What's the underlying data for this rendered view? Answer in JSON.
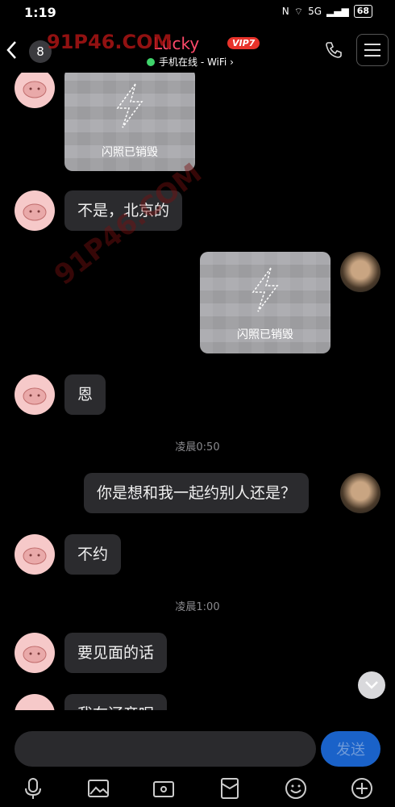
{
  "status_bar": {
    "time": "1:19",
    "signal": "5G",
    "battery": "68"
  },
  "header": {
    "unread_count": "8",
    "contact_name": "Lucky",
    "vip_label": "VIP7",
    "online_status": "手机在线 - WiFi ›"
  },
  "watermark": {
    "text_top": "91P46.COM",
    "text_diagonal": "91P46.COM"
  },
  "messages": [
    {
      "side": "left",
      "type": "flash",
      "label": "闪照已销毁"
    },
    {
      "side": "left",
      "type": "text",
      "text": "不是，北京的"
    },
    {
      "side": "right",
      "type": "flash",
      "label": "闪照已销毁"
    },
    {
      "side": "left",
      "type": "text",
      "text": "恩"
    },
    {
      "type": "time",
      "text": "凌晨0:50"
    },
    {
      "side": "right",
      "type": "text",
      "text": "你是想和我一起约别人还是？"
    },
    {
      "side": "left",
      "type": "text",
      "text": "不约"
    },
    {
      "type": "time",
      "text": "凌晨1:00"
    },
    {
      "side": "left",
      "type": "text",
      "text": "要见面的话"
    },
    {
      "side": "left",
      "type": "text",
      "text": "我在辽帝呢"
    }
  ],
  "composer": {
    "send_label": "发送"
  },
  "toolbar": {
    "icons": [
      "mic-icon",
      "image-icon",
      "camera-icon",
      "red-packet-icon",
      "emoji-icon",
      "plus-icon"
    ]
  },
  "colors": {
    "accent": "#1a62c9",
    "bubble": "#2b2b2e",
    "online": "#3fd46b",
    "vip": "#e8332b"
  }
}
